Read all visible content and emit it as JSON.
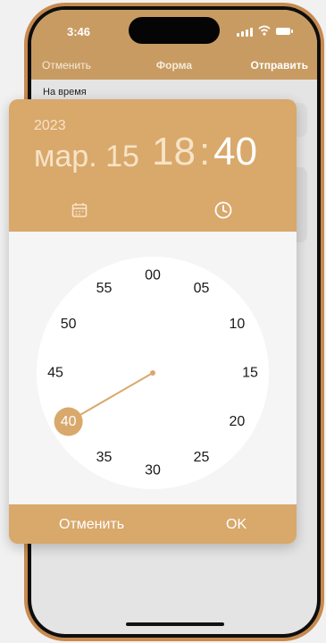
{
  "status_bar": {
    "time": "3:46"
  },
  "app_header": {
    "cancel_label": "Отменить",
    "title": "Форма",
    "submit_label": "Отправить"
  },
  "form": {
    "field_label": "На время"
  },
  "picker": {
    "year": "2023",
    "date": "мар. 15",
    "hour": "18",
    "separator": ":",
    "minute": "40",
    "tabs": [
      {
        "icon": "calendar-icon"
      },
      {
        "icon": "clock-icon"
      }
    ],
    "clock": {
      "labels": [
        "00",
        "05",
        "10",
        "15",
        "20",
        "25",
        "30",
        "35",
        "40",
        "45",
        "50",
        "55"
      ],
      "selected_minute": 40
    },
    "cancel_label": "Отменить",
    "ok_label": "OK"
  },
  "colors": {
    "accent": "#d9a86b",
    "header": "#c89b62",
    "phone_frame": "#c78a4f",
    "clock_face": "#ffffff",
    "dialog_body": "#f5f5f5",
    "label_text": "#1a1a1a"
  }
}
